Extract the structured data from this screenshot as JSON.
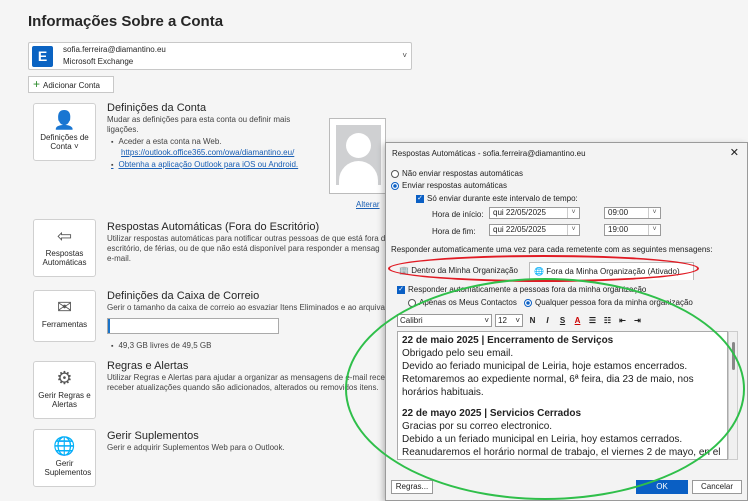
{
  "page": {
    "title": "Informações Sobre a Conta"
  },
  "account": {
    "email": "sofia.ferreira@diamantino.eu",
    "type": "Microsoft Exchange",
    "add_label": "Adicionar Conta"
  },
  "settings": {
    "btn": "Definições de Conta ˅",
    "title": "Definições da Conta",
    "desc1": "Mudar as definições para esta conta ou definir mais",
    "desc2": "ligações.",
    "b1": "Aceder a esta conta na Web.",
    "link1": "https://outlook.office365.com/owa/diamantino.eu/",
    "link2": "Obtenha a aplicação Outlook para iOS ou Android.",
    "photo_link": "Alterar"
  },
  "auto_reply": {
    "btn": "Respostas Automáticas",
    "title": "Respostas Automáticas (Fora do Escritório)",
    "d1": "Utilizar respostas automáticas para notificar outras pessoas de que está fora d",
    "d2": "escritório, de férias, ou de que não está disponível para responder a mensag",
    "d3": "e-mail."
  },
  "mailbox": {
    "btn": "Ferramentas",
    "title": "Definições da Caixa de Correio",
    "desc": "Gerir o tamanho da caixa de correio ao esvaziar Itens Eliminados e ao arquiva",
    "usage_fraction": 0.01,
    "free": "49,3 GB livres de 49,5 GB"
  },
  "rules": {
    "btn": "Gerir Regras e Alertas",
    "title": "Regras e Alertas",
    "d1": "Utilizar Regras e Alertas para ajudar a organizar as mensagens de e-mail receb",
    "d2": "receber atualizações quando são adicionados, alterados ou removidos itens."
  },
  "addins": {
    "btn": "Gerir Suplementos",
    "title": "Gerir Suplementos",
    "desc": "Gerir e adquirir Suplementos Web para o Outlook."
  },
  "dialog": {
    "title": "Respostas Automáticas - sofia.ferreira@diamantino.eu",
    "opt_off": "Não enviar respostas automáticas",
    "opt_on": "Enviar respostas automáticas",
    "range": "Só enviar durante este intervalo de tempo:",
    "start_label": "Hora de início:",
    "start_date": "qui 22/05/2025",
    "start_time": "09:00",
    "end_label": "Hora de fim:",
    "end_date": "qui 22/05/2025",
    "end_time": "19:00",
    "respond_text": "Responder automaticamente uma vez para cada remetente com as seguintes mensagens:",
    "tab_inside": "Dentro da Minha Organização",
    "tab_outside": "Fora da Minha Organização (Ativado)",
    "outside_chk": "Responder automaticamente a pessoas fora da minha organização",
    "only_contacts": "Apenas os Meus Contactos",
    "anyone": "Qualquer pessoa fora da minha organização",
    "font": "Calibri",
    "size": "12",
    "msg": {
      "l1": "22 de maio 2025 | Encerramento de Serviços",
      "l2": "Obrigado pelo seu email.",
      "l3": "Devido ao feriado municipal de Leiria, hoje estamos encerrados.",
      "l4": "Retomaremos ao expediente normal, 6ª feira, dia 23 de maio, nos",
      "l5": "horários habituais.",
      "l6": "22 de mayo 2025 | Servicios Cerrados",
      "l7": "Gracias por su correo electronico.",
      "l8": "Debido a un feriado municipal en Leiria, hoy estamos cerrados.",
      "l9": "Reanudaremos el horário normal de trabajo, el viernes 2 de mayo, en el"
    },
    "rules_btn": "Regras...",
    "ok": "OK",
    "cancel": "Cancelar"
  }
}
